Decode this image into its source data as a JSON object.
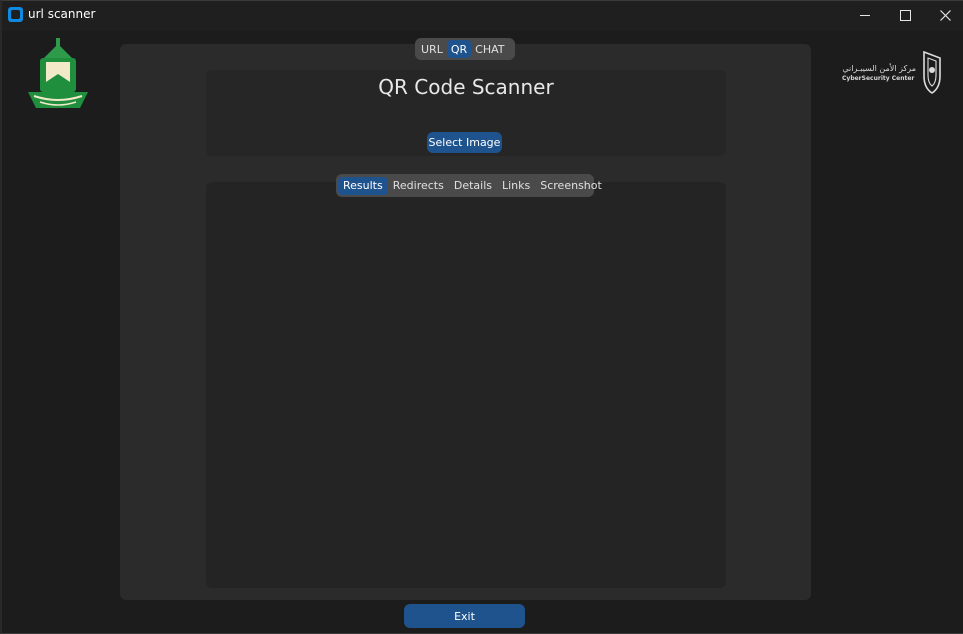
{
  "window": {
    "title": "url scanner",
    "minimize_icon": "minimize-icon",
    "maximize_icon": "maximize-icon",
    "close_icon": "close-icon"
  },
  "logos": {
    "left": "kau-logo",
    "right": "cybersecurity-center-logo",
    "right_text_ar": "مركز الأمن السيبـراني",
    "right_text_en": "CyberSecurity Center"
  },
  "top_tabs": [
    {
      "label": "URL",
      "active": false
    },
    {
      "label": "QR",
      "active": true
    },
    {
      "label": "CHAT",
      "active": false
    }
  ],
  "qr": {
    "title": "QR Code Scanner",
    "select_label": "Select Image"
  },
  "result_tabs": [
    {
      "label": "Results",
      "active": true
    },
    {
      "label": "Redirects",
      "active": false
    },
    {
      "label": "Details",
      "active": false
    },
    {
      "label": "Links",
      "active": false
    },
    {
      "label": "Screenshot",
      "active": false
    }
  ],
  "footer": {
    "exit_label": "Exit"
  },
  "colors": {
    "accent": "#1f538d",
    "background": "#1c1c1c",
    "frame": "#2b2b2b",
    "segmented": "#4a4a4a"
  }
}
